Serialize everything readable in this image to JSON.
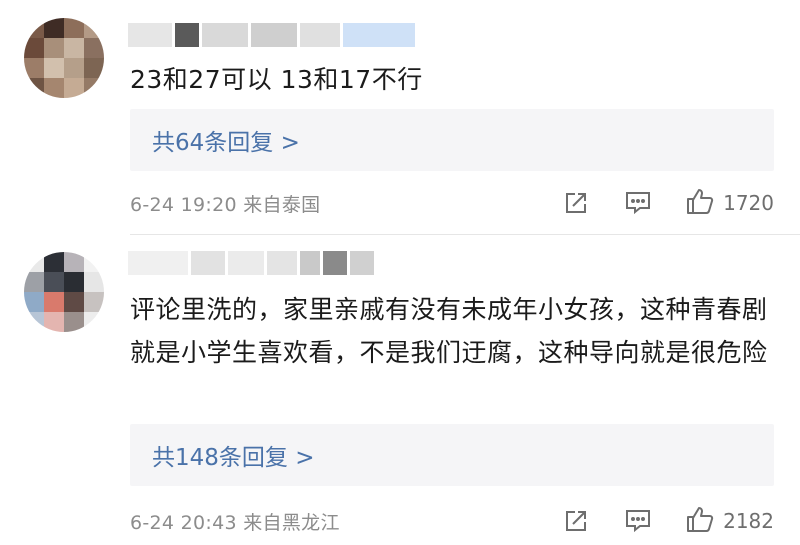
{
  "comments": [
    {
      "text": "23和27可以 13和17不行",
      "replies_label": "共64条回复 >",
      "time": "6-24 19:20 来自泰国",
      "likes": "1720"
    },
    {
      "text": "评论里洗的，家里亲戚有没有未成年小女孩，这种青春剧就是小学生喜欢看，不是我们迂腐，这种导向就是很危险",
      "replies_label": "共148条回复 >",
      "time": "6-24 20:43 来自黑龙江",
      "likes": "2182"
    }
  ],
  "colors": {
    "link_blue": "#4a72a9",
    "reply_bg": "#f5f5f7",
    "meta_gray": "#8c8c8c"
  },
  "icons": [
    "share-icon",
    "comment-icon",
    "thumbs-up-icon"
  ]
}
